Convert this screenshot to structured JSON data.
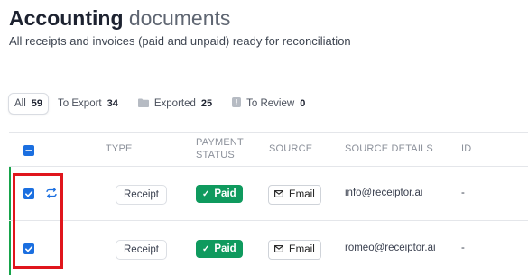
{
  "header": {
    "title_bold": "Accounting",
    "title_rest": "documents",
    "subtitle": "All receipts and invoices (paid and unpaid) ready for reconciliation"
  },
  "tabs": [
    {
      "label": "All",
      "count": "59",
      "active": true
    },
    {
      "label": "To Export",
      "count": "34"
    },
    {
      "label": "Exported",
      "count": "25",
      "icon": "folder-icon"
    },
    {
      "label": "To Review",
      "count": "0",
      "icon": "info-icon"
    }
  ],
  "table": {
    "columns": {
      "type": "TYPE",
      "payment_status": "PAYMENT\nSTATUS",
      "source": "SOURCE",
      "source_details": "SOURCE DETAILS",
      "id": "ID"
    },
    "rows": [
      {
        "type": "Receipt",
        "payment_status": "Paid",
        "source": "Email",
        "source_details": "info@receiptor.ai",
        "id": "-",
        "synced": true
      },
      {
        "type": "Receipt",
        "payment_status": "Paid",
        "source": "Email",
        "source_details": "romeo@receiptor.ai",
        "id": "-",
        "synced": false
      }
    ]
  },
  "colors": {
    "accent": "#1b6fe0",
    "paid": "#0f9a5e",
    "highlight": "#e0161c",
    "row_indicator": "#16a34a"
  }
}
